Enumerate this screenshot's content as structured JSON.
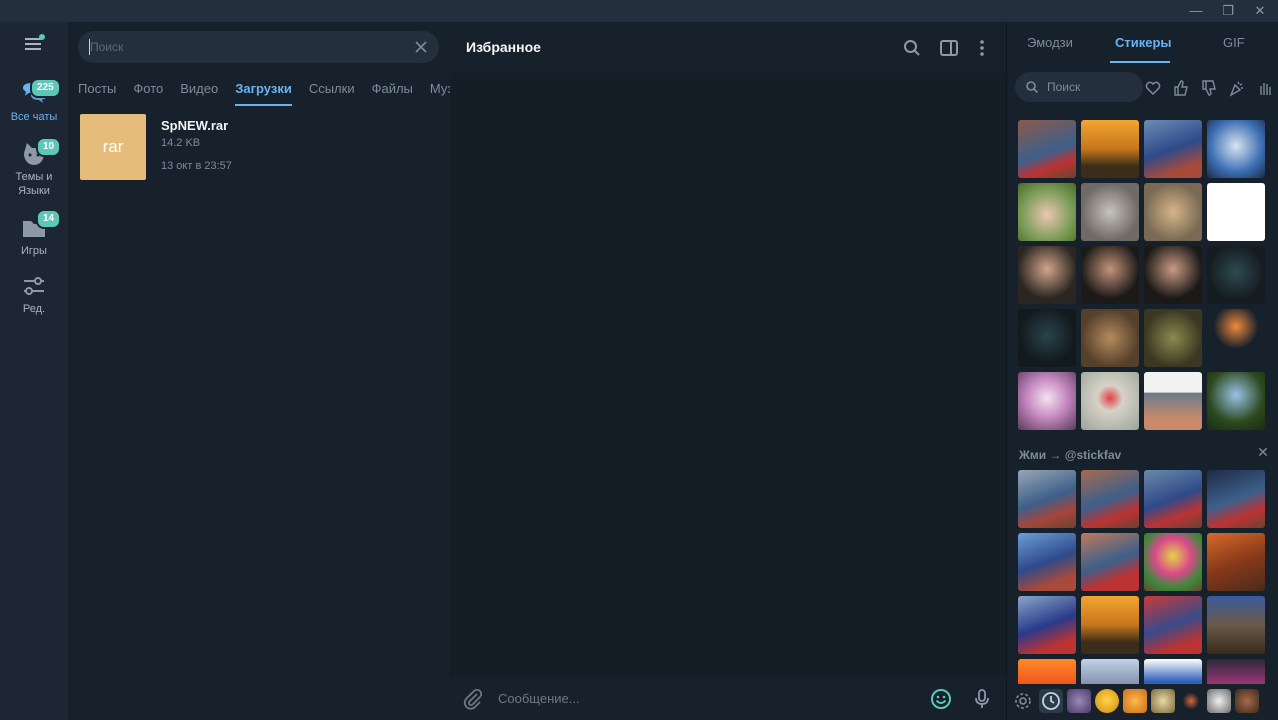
{
  "window": {
    "minimize": "—",
    "restore": "❐",
    "close": "✕"
  },
  "rail": {
    "items": [
      {
        "label": "Все чаты",
        "badge": "225",
        "icon": "chats-icon",
        "active": true
      },
      {
        "label": "Темы и Языки",
        "badge": "10",
        "icon": "cat-icon",
        "active": false
      },
      {
        "label": "Игры",
        "badge": "14",
        "icon": "folder-icon",
        "active": false
      },
      {
        "label": "Ред.",
        "badge": "",
        "icon": "sliders-icon",
        "active": false
      }
    ]
  },
  "left": {
    "search_placeholder": "Поиск",
    "tabs": [
      "Посты",
      "Фото",
      "Видео",
      "Загрузки",
      "Ссылки",
      "Файлы",
      "Музыка"
    ],
    "active_tab": "Загрузки",
    "files": [
      {
        "thumb": "rar",
        "name": "SpNEW.rar",
        "size": "14.2 KB",
        "date": "13 окт в 23:57"
      }
    ]
  },
  "chat": {
    "title": "Избранное",
    "composer_placeholder": "Сообщение..."
  },
  "panel": {
    "tabs": [
      "Эмодзи",
      "Стикеры",
      "GIF"
    ],
    "active_tab": "Стикеры",
    "search_placeholder": "Поиск",
    "section_title": "Жми → @stickfav",
    "colors": {
      "accent": "#6ab3f3",
      "badge": "#5fc7b5",
      "file_thumb": "#e5bc7a"
    }
  }
}
